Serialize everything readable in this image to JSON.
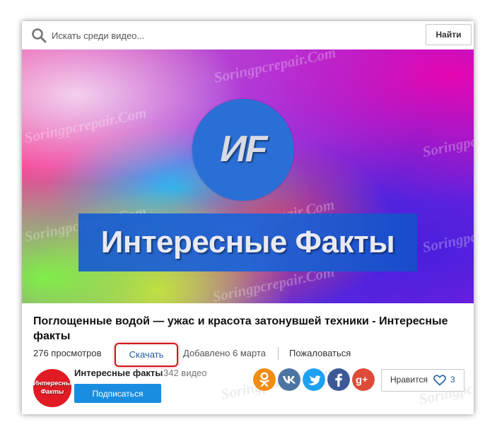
{
  "search": {
    "placeholder": "Искать среди видео...",
    "value": "",
    "button_label": "Найти",
    "icon": "search-icon"
  },
  "thumbnail": {
    "logo_text": "ИF",
    "banner_text": "Интересные Факты",
    "watermark": "Soringpcrepair.Com"
  },
  "video": {
    "title": "Поглощенные водой — ужас и красота затонувшей техники - Интересные факты",
    "views": "276 просмотров",
    "download_label": "Скачать",
    "added": "Добавлено 6 марта",
    "report_label": "Пожаловаться",
    "highlight_color": "#d2161e"
  },
  "channel": {
    "name": "Интересные факты",
    "video_count": "342 видео",
    "avatar_text": "Интересные Факты",
    "subscribe_label": "Подписаться"
  },
  "share": [
    {
      "network": "odnoklassniki",
      "icon": "odnoklassniki-icon",
      "color": "#f28c14"
    },
    {
      "network": "vkontakte",
      "icon": "vk-icon",
      "color": "#4d75a3"
    },
    {
      "network": "twitter",
      "icon": "twitter-icon",
      "color": "#1da1f2"
    },
    {
      "network": "facebook",
      "icon": "facebook-icon",
      "color": "#3b5998"
    },
    {
      "network": "google-plus",
      "icon": "google-plus-icon",
      "color": "#dd4b39"
    }
  ],
  "like": {
    "label": "Нравится",
    "count": "3",
    "icon": "heart-icon"
  }
}
